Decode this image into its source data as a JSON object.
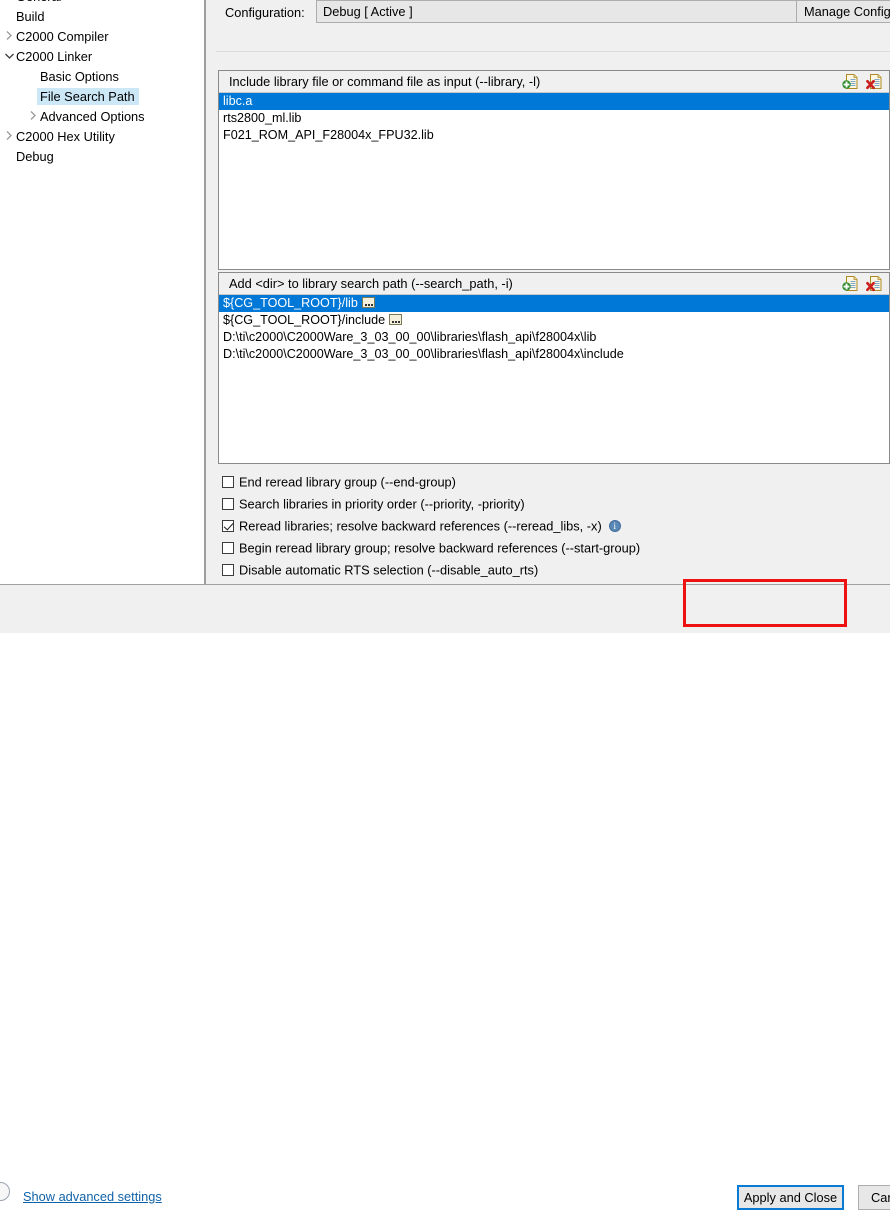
{
  "colors": {
    "selection_blue": "#0078d7",
    "tree_selection": "#cce8f7",
    "panel_bg": "#f0f0f0",
    "link_blue": "#1062a8",
    "highlight_red": "#ee1111",
    "focus_blue": "#0a7bd4"
  },
  "tree": {
    "items": [
      {
        "label": "General",
        "indent": 0,
        "twisty": "none",
        "selected": false,
        "clipped": true
      },
      {
        "label": "Build",
        "indent": 0,
        "twisty": "none",
        "selected": false
      },
      {
        "label": "C2000 Compiler",
        "indent": 0,
        "twisty": "collapsed",
        "selected": false
      },
      {
        "label": "C2000 Linker",
        "indent": 0,
        "twisty": "expanded",
        "selected": false
      },
      {
        "label": "Basic Options",
        "indent": 1,
        "twisty": "none",
        "selected": false
      },
      {
        "label": "File Search Path",
        "indent": 1,
        "twisty": "none",
        "selected": true
      },
      {
        "label": "Advanced Options",
        "indent": 1,
        "twisty": "collapsed",
        "selected": false
      },
      {
        "label": "C2000 Hex Utility",
        "indent": 0,
        "twisty": "collapsed",
        "selected": false
      },
      {
        "label": "Debug",
        "indent": 0,
        "twisty": "none",
        "selected": false
      }
    ]
  },
  "config": {
    "label": "Configuration:",
    "value": "Debug  [ Active ]",
    "manage_label": "Manage Configurations...",
    "dropdown_icon": "chevron-down-icon"
  },
  "library_group": {
    "title": "Include library file or command file as input (--library, -l)",
    "add_icon": "add-file-icon",
    "delete_icon": "delete-file-icon",
    "items": [
      {
        "text": "libc.a",
        "selected": true,
        "badge": false
      },
      {
        "text": "rts2800_ml.lib",
        "selected": false,
        "badge": false
      },
      {
        "text": "F021_ROM_API_F28004x_FPU32.lib",
        "selected": false,
        "badge": false
      }
    ]
  },
  "searchpath_group": {
    "title": "Add <dir> to library search path (--search_path, -i)",
    "add_icon": "add-file-icon",
    "delete_icon": "delete-file-icon",
    "items": [
      {
        "text": "${CG_TOOL_ROOT}/lib",
        "selected": true,
        "badge": true
      },
      {
        "text": "${CG_TOOL_ROOT}/include",
        "selected": false,
        "badge": true
      },
      {
        "text": "D:\\ti\\c2000\\C2000Ware_3_03_00_00\\libraries\\flash_api\\f28004x\\lib",
        "selected": false,
        "badge": false
      },
      {
        "text": "D:\\ti\\c2000\\C2000Ware_3_03_00_00\\libraries\\flash_api\\f28004x\\include",
        "selected": false,
        "badge": false
      }
    ]
  },
  "options": {
    "checkboxes": [
      {
        "label": "End reread library group (--end-group)",
        "checked": false,
        "info": false
      },
      {
        "label": "Search libraries in priority order (--priority, -priority)",
        "checked": false,
        "info": false
      },
      {
        "label": "Reread libraries; resolve backward references (--reread_libs, -x)",
        "checked": true,
        "info": true
      },
      {
        "label": "Begin reread library group; resolve backward references (--start-group)",
        "checked": false,
        "info": false
      },
      {
        "label": "Disable automatic RTS selection (--disable_auto_rts)",
        "checked": false,
        "info": false
      }
    ]
  },
  "bottom": {
    "help_icon": "help-circle-icon",
    "advanced_link": "Show advanced settings",
    "apply_label": "Apply and Close",
    "cancel_label": "Cancel"
  }
}
